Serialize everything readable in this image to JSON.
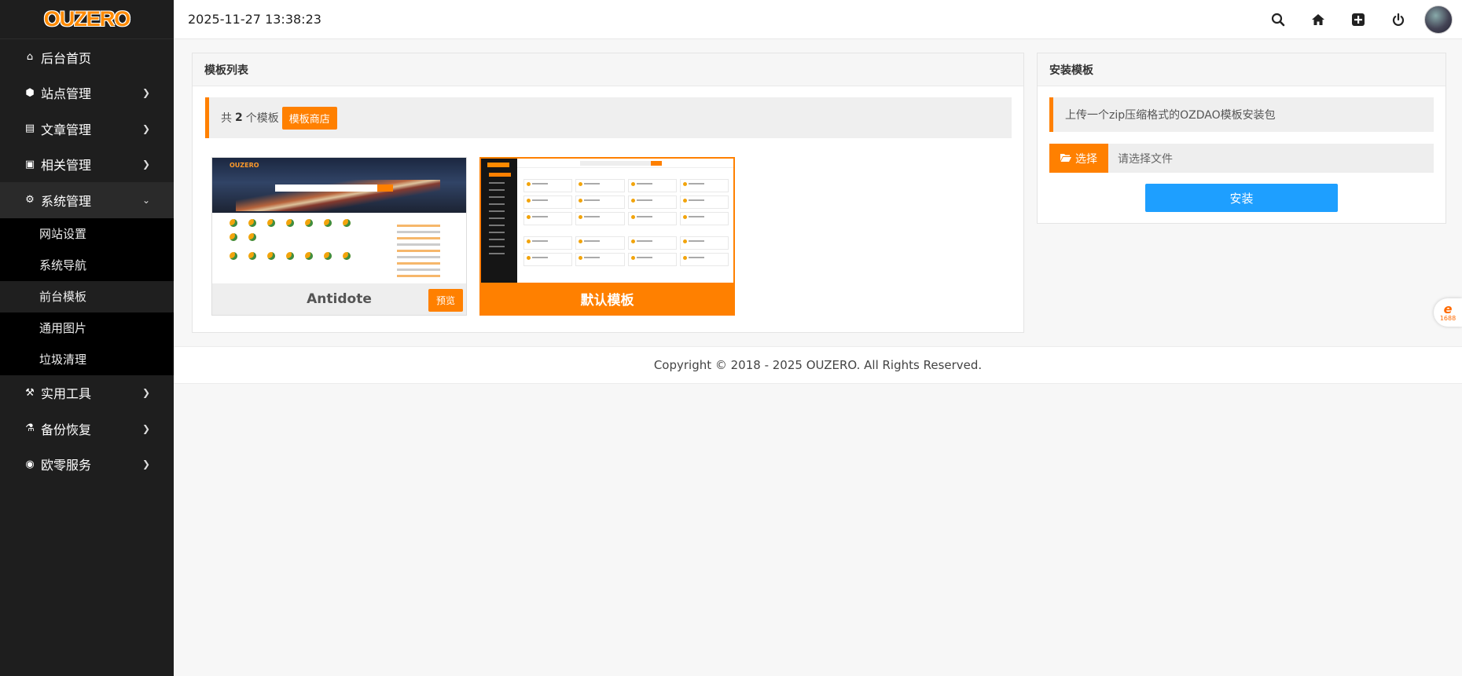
{
  "brand": {
    "logo": "OUZERO",
    "accent": "#ff8000",
    "blue": "#1e9fff"
  },
  "topbar": {
    "datetime": "2025-11-27 13:38:23",
    "icons": [
      "search-icon",
      "home-icon",
      "plus-square-icon",
      "power-icon",
      "avatar"
    ]
  },
  "sidebar": {
    "items": [
      {
        "label": "后台首页",
        "icon": "home-icon",
        "glyph": "⌂",
        "has_children": false
      },
      {
        "label": "站点管理",
        "icon": "cube-icon",
        "glyph": "⬢",
        "has_children": true
      },
      {
        "label": "文章管理",
        "icon": "book-icon",
        "glyph": "▤",
        "has_children": true
      },
      {
        "label": "相关管理",
        "icon": "gift-icon",
        "glyph": "▣",
        "has_children": true
      },
      {
        "label": "系统管理",
        "icon": "gear-icon",
        "glyph": "⚙",
        "has_children": true,
        "open": true
      },
      {
        "label": "实用工具",
        "icon": "hammer-icon",
        "glyph": "⚒",
        "has_children": true
      },
      {
        "label": "备份恢复",
        "icon": "flask-icon",
        "glyph": "⚗",
        "has_children": true
      },
      {
        "label": "欧零服务",
        "icon": "target-icon",
        "glyph": "◉",
        "has_children": true
      }
    ],
    "system_submenu": [
      {
        "label": "网站设置",
        "active": false
      },
      {
        "label": "系统导航",
        "active": false
      },
      {
        "label": "前台模板",
        "active": true
      },
      {
        "label": "通用图片",
        "active": false
      },
      {
        "label": "垃圾清理",
        "active": false
      }
    ]
  },
  "templates_panel": {
    "title": "模板列表",
    "count_prefix": "共",
    "count": "2",
    "count_suffix": "个模板",
    "store_button": "模板商店",
    "cards": [
      {
        "name": "Antidote",
        "preview_label": "预览",
        "active": false
      },
      {
        "name": "默认模板",
        "active": true
      }
    ]
  },
  "install_panel": {
    "title": "安装模板",
    "info": "上传一个zip压缩格式的OZDAO模板安装包",
    "choose_label": "选择",
    "file_placeholder": "请选择文件",
    "install_button": "安装"
  },
  "footer": {
    "copyright": "Copyright © 2018 - 2025 OUZERO. All Rights Reserved."
  },
  "float_badge": {
    "text": "1688"
  }
}
